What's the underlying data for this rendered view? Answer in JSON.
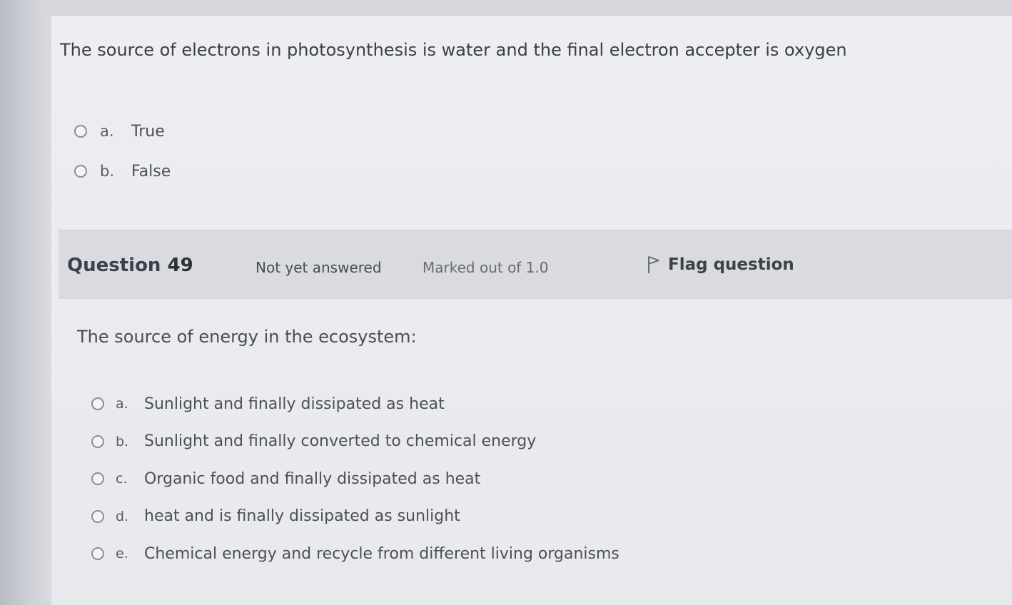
{
  "question_prev": {
    "text": "The source of electrons in photosynthesis is water and the final electron accepter is oxygen",
    "options": [
      {
        "letter": "a.",
        "text": "True"
      },
      {
        "letter": "b.",
        "text": "False"
      }
    ]
  },
  "question_49": {
    "label": "Question",
    "number": "49",
    "status": "Not yet answered",
    "marks": "Marked out of 1.0",
    "flag_label": "Flag question",
    "text": "The source of energy in the ecosystem:",
    "options": [
      {
        "letter": "a.",
        "text": "Sunlight and finally dissipated as heat"
      },
      {
        "letter": "b.",
        "text": "Sunlight and finally converted to chemical energy"
      },
      {
        "letter": "c.",
        "text": "Organic food and finally dissipated as heat"
      },
      {
        "letter": "d.",
        "text": "heat and is finally dissipated as sunlight"
      },
      {
        "letter": "e.",
        "text": "Chemical energy and recycle from different living organisms"
      }
    ]
  },
  "icons": {
    "radio": "radio-unchecked-icon",
    "flag": "flag-icon"
  }
}
